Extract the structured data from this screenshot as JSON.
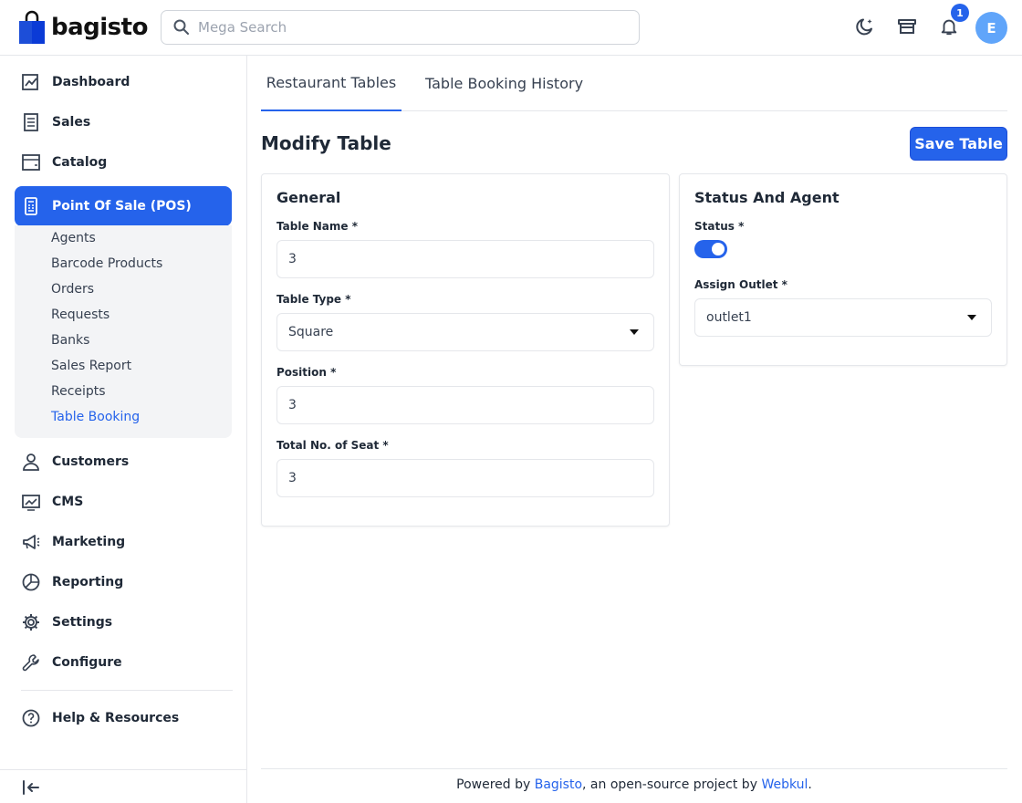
{
  "brand": {
    "name": "bagisto"
  },
  "search": {
    "placeholder": "Mega Search"
  },
  "notifications": {
    "count": "1"
  },
  "user": {
    "initial": "E"
  },
  "sidebar": {
    "items": [
      {
        "label": "Dashboard"
      },
      {
        "label": "Sales"
      },
      {
        "label": "Catalog"
      },
      {
        "label": "Point Of Sale (POS)"
      },
      {
        "label": "Customers"
      },
      {
        "label": "CMS"
      },
      {
        "label": "Marketing"
      },
      {
        "label": "Reporting"
      },
      {
        "label": "Settings"
      },
      {
        "label": "Configure"
      },
      {
        "label": "Help & Resources"
      }
    ],
    "pos_submenu": [
      {
        "label": "Agents"
      },
      {
        "label": "Barcode Products"
      },
      {
        "label": "Orders"
      },
      {
        "label": "Requests"
      },
      {
        "label": "Banks"
      },
      {
        "label": "Sales Report"
      },
      {
        "label": "Receipts"
      },
      {
        "label": "Table Booking"
      }
    ]
  },
  "tabs": [
    {
      "label": "Restaurant Tables"
    },
    {
      "label": "Table Booking History"
    }
  ],
  "page": {
    "title": "Modify Table",
    "save_label": "Save Table"
  },
  "general": {
    "title": "General",
    "table_name_label": "Table Name *",
    "table_name_value": "3",
    "table_type_label": "Table Type *",
    "table_type_value": "Square",
    "position_label": "Position *",
    "position_value": "3",
    "seats_label": "Total No. of Seat *",
    "seats_value": "3"
  },
  "status_agent": {
    "title": "Status And Agent",
    "status_label": "Status *",
    "status_on": true,
    "outlet_label": "Assign Outlet *",
    "outlet_value": "outlet1"
  },
  "footer": {
    "prefix": "Powered by ",
    "bagisto_link": "Bagisto",
    "middle": ", an open-source project by ",
    "webkul_link": "Webkul",
    "suffix": "."
  },
  "colors": {
    "accent": "#2563eb",
    "avatar": "#60a5fa"
  }
}
